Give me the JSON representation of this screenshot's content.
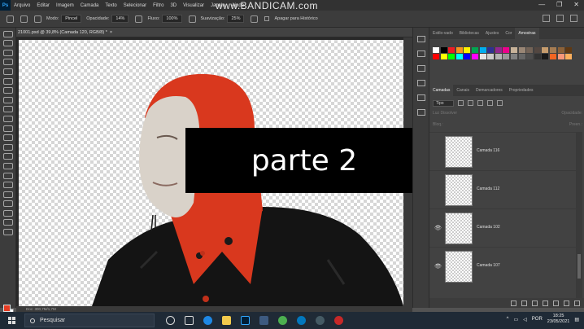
{
  "recorder_watermark": "www.BANDICAM.com",
  "menu": {
    "app_logo": "Ps",
    "items": [
      "Arquivo",
      "Editar",
      "Imagem",
      "Camada",
      "Texto",
      "Selecionar",
      "Filtro",
      "3D",
      "Visualizar",
      "Janela",
      "Ajuda"
    ]
  },
  "options": {
    "mode_label": "Modo:",
    "mode_value": "Pincel",
    "opacity_label": "Opacidade:",
    "opacity_value": "14%",
    "flow_label": "Fluxo:",
    "flow_value": "100%",
    "smoothing_label": "Suavização:",
    "smoothing_value": "25%",
    "history_label": "Apagar para Histórico"
  },
  "document": {
    "tab_title": "21001.psd @ 39,8% (Camada 120, RGB/8) *",
    "close": "×",
    "status": "Doc: 300,7M/1,7M"
  },
  "overlay_text": "parte 2",
  "panels": {
    "top_tabs": [
      "Estilo-vado",
      "Bibliotecas",
      "Ajustes",
      "Cor",
      "Amostras"
    ],
    "active_top_tab": "Amostras",
    "swatches": [
      "#ffffff",
      "#000000",
      "#ed1c24",
      "#f7941d",
      "#fff200",
      "#00a651",
      "#00aeef",
      "#2e3192",
      "#92278f",
      "#ec008c",
      "#c7b299",
      "#998675",
      "#736357",
      "#534741",
      "#c69c6d",
      "#a67c52",
      "#8c6239",
      "#603913",
      "#ff0000",
      "#ffff00",
      "#00ff00",
      "#00ffff",
      "#0000ff",
      "#ff00ff",
      "#e6e6e6",
      "#cccccc",
      "#b3b3b3",
      "#999999",
      "#808080",
      "#666666",
      "#4d4d4d",
      "#333333",
      "#1a1a1a",
      "#f26522",
      "#f7977a",
      "#fbaf5d"
    ],
    "layer_tabs": [
      "Camadas",
      "Canais",
      "Demarcadores",
      "Propriedades"
    ],
    "active_layer_tab": "Camadas",
    "filter_kind": "Tipo",
    "blend_mode": "Luz Dissolver",
    "opacity_label": "Opacidade:",
    "lock_label": "Bloq.:",
    "fill_label": "Preen.:",
    "layers": [
      {
        "name": "Camada 116",
        "visible": false
      },
      {
        "name": "Camada 112",
        "visible": false
      },
      {
        "name": "Camada 102",
        "visible": true
      },
      {
        "name": "Camada 107",
        "visible": true
      }
    ]
  },
  "taskbar": {
    "search_placeholder": "Pesquisar",
    "language": "POR",
    "time": "18:25",
    "date": "23/05/2021"
  }
}
